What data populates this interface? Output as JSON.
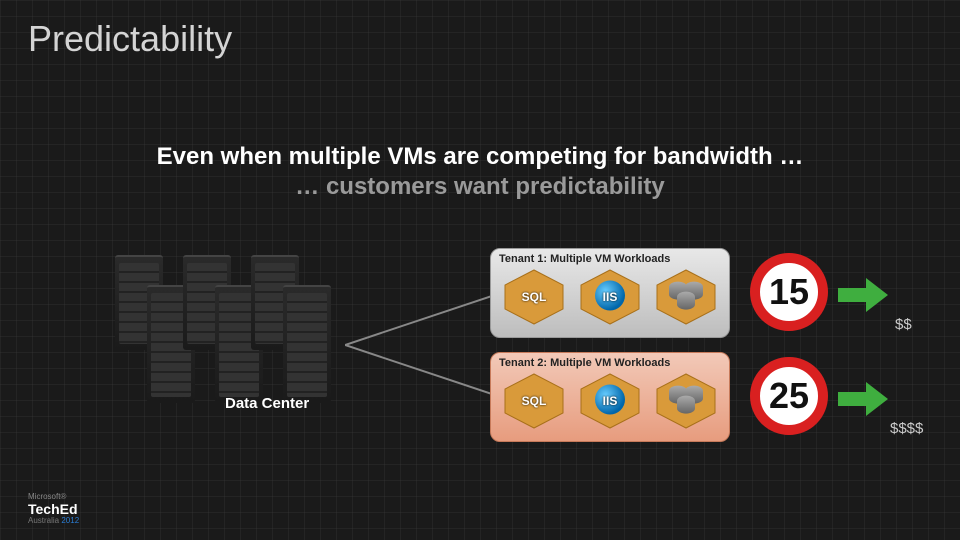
{
  "title": "Predictability",
  "subtitle_line1": "Even when multiple VMs are competing for bandwidth …",
  "subtitle_line2": "… customers want predictability",
  "datacenter_label": "Data Center",
  "tenant1": {
    "label": "Tenant 1: Multiple VM Workloads",
    "vm_sql": "SQL",
    "vm_iis": "IIS",
    "metric": "15",
    "cost": "$$"
  },
  "tenant2": {
    "label": "Tenant 2: Multiple VM Workloads",
    "vm_sql": "SQL",
    "vm_iis": "IIS",
    "metric": "25",
    "cost": "$$$$"
  },
  "footer": {
    "ms": "Microsoft®",
    "brand": "TechEd",
    "region": "Australia",
    "year": "2012"
  }
}
